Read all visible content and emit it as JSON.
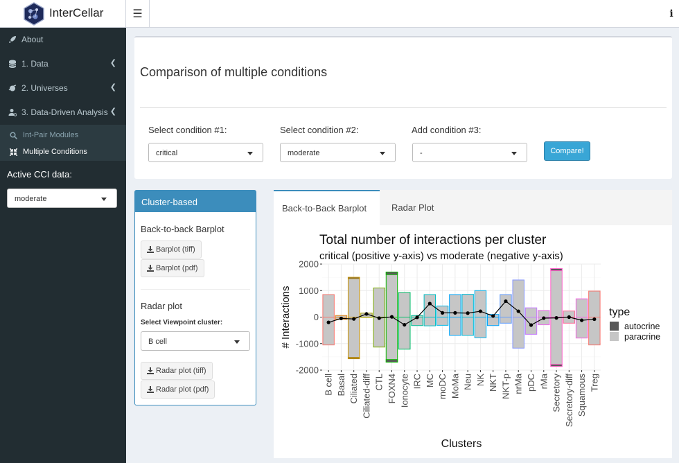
{
  "app": {
    "title": "InterCellar"
  },
  "sidebar": {
    "items": [
      {
        "label": "About",
        "icon": "rocket-icon"
      },
      {
        "label": "1. Data",
        "icon": "database-icon"
      },
      {
        "label": "2. Universes",
        "icon": "universe-icon"
      },
      {
        "label": "3. Data-Driven Analysis",
        "icon": "users-cog-icon"
      }
    ],
    "submenu": [
      {
        "label": "Int-Pair Modules",
        "icon": "search-icon"
      },
      {
        "label": "Multiple Conditions",
        "icon": "compress-icon"
      }
    ],
    "active_cci_label": "Active CCI data:",
    "active_cci_value": "moderate"
  },
  "main": {
    "title": "Comparison of multiple conditions",
    "conditions": [
      {
        "label": "Select condition #1:",
        "value": "critical"
      },
      {
        "label": "Select condition #2:",
        "value": "moderate"
      },
      {
        "label": "Add condition #3:",
        "value": "-"
      }
    ],
    "compare_label": "Compare!"
  },
  "cluster_box": {
    "header": "Cluster-based",
    "barplot_title": "Back-to-back Barplot",
    "barplot_tiff": "Barplot (tiff)",
    "barplot_pdf": "Barplot (pdf)",
    "radar_title": "Radar plot",
    "viewpoint_label": "Select Viewpoint cluster:",
    "viewpoint_value": "B cell",
    "radar_tiff": "Radar plot (tiff)",
    "radar_pdf": "Radar plot (pdf)"
  },
  "tabs": [
    {
      "label": "Back-to-Back Barplot"
    },
    {
      "label": "Radar Plot"
    }
  ],
  "chart_data": {
    "type": "bar",
    "title": "Total number of interactions per cluster",
    "subtitle": "critical (positive y-axis) vs moderate  (negative y-axis)",
    "xlabel": "Clusters",
    "ylabel": "# Interactions",
    "ylim": [
      -2000,
      2000
    ],
    "yticks": [
      2000,
      1000,
      0,
      -1000,
      -2000
    ],
    "legend_title": "type",
    "legend": [
      {
        "name": "autocrine",
        "color": "#595959"
      },
      {
        "name": "paracrine",
        "color": "#c6c6c6"
      }
    ],
    "categories": [
      "B cell",
      "Basal",
      "Ciliated",
      "Ciliated-diff",
      "CTL",
      "FOXN4",
      "Ionocyte",
      "IRC",
      "MC",
      "moDC",
      "MoMa",
      "Neu",
      "NK",
      "NKT",
      "NKT-p",
      "nrMa",
      "pDC",
      "rMa",
      "Secretory",
      "Secretory-diff",
      "Squamous",
      "Treg"
    ],
    "outline_colors": [
      "#f8766d",
      "#e68613",
      "#cd9600",
      "#aba300",
      "#7cae00",
      "#0cb702",
      "#00be67",
      "#00c19a",
      "#00bfc4",
      "#00b8e7",
      "#00a9ff",
      "#00bcd8",
      "#00b4f0",
      "#00a5ff",
      "#619cff",
      "#8494ff",
      "#c77cff",
      "#ed68ed",
      "#ff61c9",
      "#ff6a98",
      "#f564e3",
      "#f8766d"
    ],
    "series": [
      {
        "name": "critical paracrine",
        "values": [
          850,
          60,
          1450,
          150,
          1100,
          1600,
          930,
          60,
          850,
          420,
          850,
          860,
          1000,
          100,
          850,
          1400,
          350,
          250,
          1750,
          230,
          690,
          980
        ]
      },
      {
        "name": "critical autocrine",
        "values": [
          0,
          0,
          50,
          0,
          0,
          100,
          0,
          0,
          0,
          0,
          0,
          0,
          0,
          0,
          0,
          0,
          0,
          0,
          80,
          0,
          0,
          0
        ]
      },
      {
        "name": "moderate paracrine",
        "values": [
          -1050,
          -80,
          -1520,
          -10,
          -1130,
          -1600,
          -1210,
          -320,
          -330,
          -310,
          -690,
          -690,
          -780,
          -320,
          -230,
          -1170,
          -650,
          -290,
          -1780,
          -230,
          -790,
          -1050
        ]
      },
      {
        "name": "moderate autocrine",
        "values": [
          0,
          0,
          -50,
          0,
          0,
          -100,
          0,
          0,
          0,
          0,
          0,
          0,
          0,
          0,
          0,
          0,
          0,
          0,
          -80,
          0,
          0,
          0
        ]
      },
      {
        "name": "net",
        "values": [
          -200,
          -50,
          -70,
          120,
          -40,
          10,
          -290,
          -10,
          510,
          160,
          160,
          150,
          220,
          40,
          600,
          220,
          -300,
          -40,
          -30,
          0,
          -120,
          -80
        ]
      }
    ]
  }
}
